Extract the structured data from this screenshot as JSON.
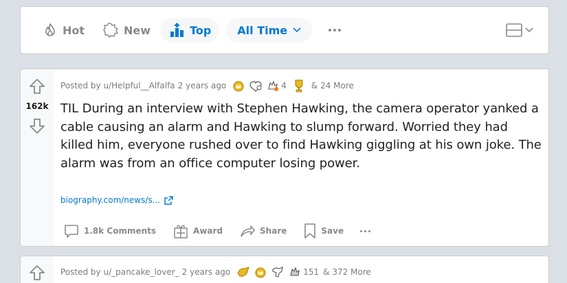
{
  "sort_bar": {
    "items": [
      {
        "label": "Hot",
        "icon": "flame-icon",
        "active": false
      },
      {
        "label": "New",
        "icon": "sparkle-badge-icon",
        "active": false
      },
      {
        "label": "Top",
        "icon": "bar-chart-up-icon",
        "active": true
      }
    ],
    "time_filter": {
      "label": "All Time",
      "icon": "chevron-down-icon"
    },
    "more_icon": "ellipsis-icon",
    "view_toggle_icon": "card-view-icon"
  },
  "posts": [
    {
      "score": "162k",
      "posted_by": "Posted by u/Helpful__Alfalfa",
      "age": "2 years ago",
      "award_icons": [
        "gold-award-icon",
        "wholesome-award-icon",
        "helpful-award-icon",
        "trophy-award-icon"
      ],
      "award_count": "4",
      "more_awards": "& 24 More",
      "title": "TIL During an interview with Stephen Hawking, the camera operator yanked a cable causing an alarm and Hawking to slump forward. Worried they had killed him, everyone rushed over to find Hawking giggling at his own joke. The alarm was from an office computer losing power.",
      "link": "biography.com/news/s...",
      "actions": {
        "comments": "1.8k Comments",
        "award": "Award",
        "share": "Share",
        "save": "Save"
      }
    },
    {
      "posted_by": "Posted by u/_pancake_lover_",
      "age": "2 years ago",
      "award_icons": [
        "silver-award-icon",
        "gold-award-icon",
        "dog-award-icon",
        "hand-award-icon"
      ],
      "award_count": "151",
      "more_awards": "& 372 More"
    }
  ],
  "colors": {
    "background": "#dae0e6",
    "accent": "#0079d3",
    "muted": "#878a8c",
    "gold": "#e8b923"
  }
}
